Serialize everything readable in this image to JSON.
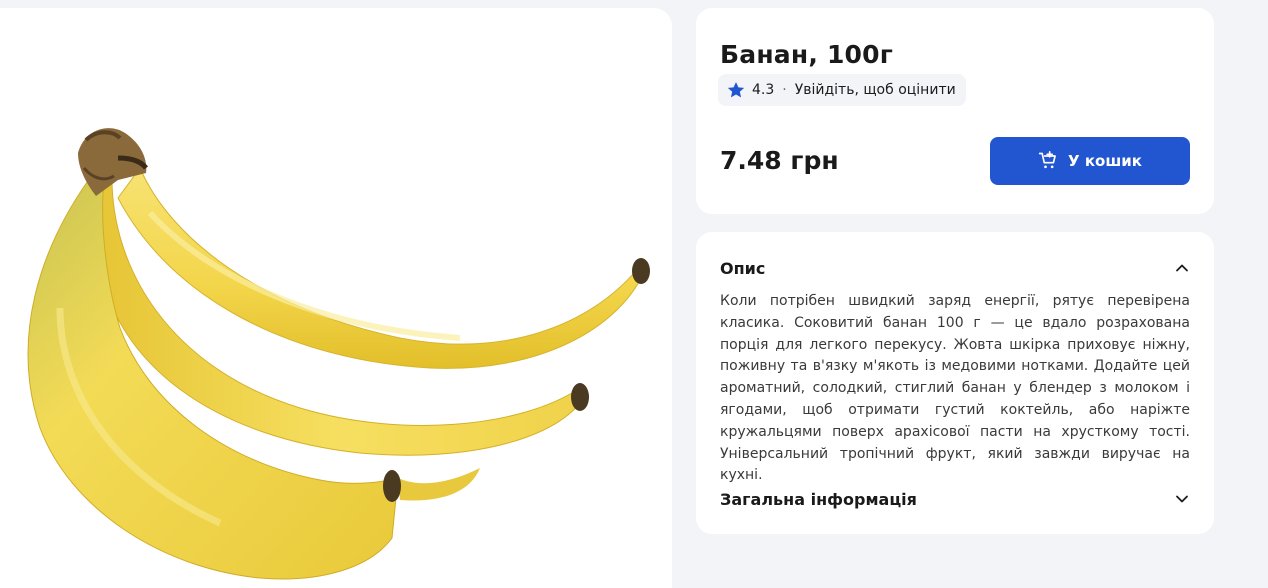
{
  "product": {
    "image_alt": "banana-bunch",
    "title": "Банан, 100г",
    "rating": "4.3",
    "rating_separator": "·",
    "rating_login": "Увійдіть, щоб оцінити",
    "price": "7.48 грн",
    "add_to_cart_label": "У кошик"
  },
  "description": {
    "heading": "Опис",
    "text": "Коли потрібен швидкий заряд енергії, рятує перевірена класика. Соковитий банан 100 г — це вдало розрахована порція для легкого перекусу. Жовта шкірка приховує ніжну, поживну та в'язку м'якоть із медовими нотками. Додайте цей ароматний, солодкий, стиглий банан у блендер з молоком і ягодами, щоб отримати густий коктейль, або наріжте кружальцями поверх арахісової пасти на хрусткому тості. Універсальний тропічний фрукт, який завжди виручає на кухні."
  },
  "general_info": {
    "heading": "Загальна інформація"
  },
  "icons": {
    "rating": "star-icon",
    "cart": "cart-plus-icon",
    "collapse": "chevron-up-icon",
    "expand": "chevron-down-icon"
  },
  "colors": {
    "accent": "#2255d0",
    "background": "#f2f4f8",
    "card": "#ffffff",
    "banana": "#f5dc5a"
  }
}
